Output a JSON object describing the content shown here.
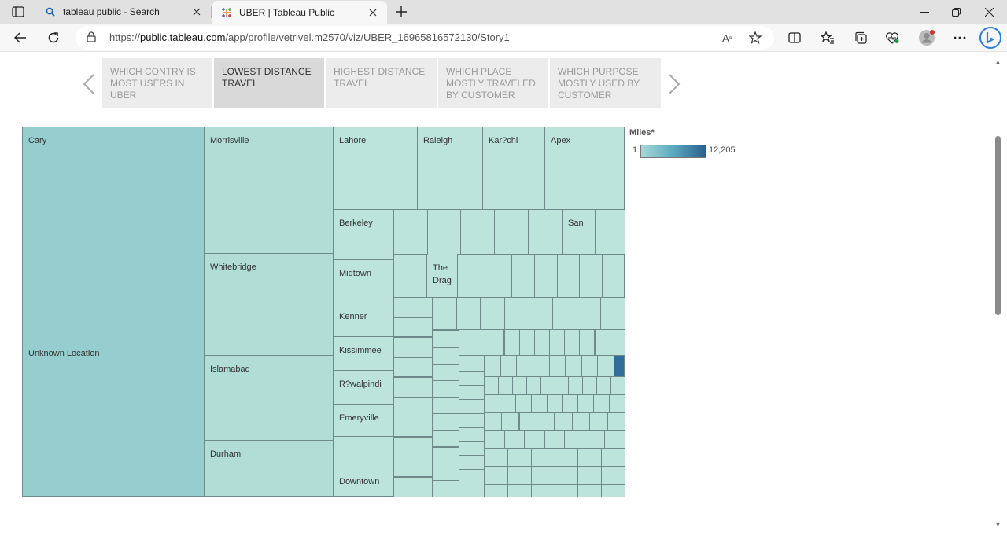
{
  "browser": {
    "tabs": [
      {
        "title": "tableau public - Search",
        "icon": "search-icon",
        "active": false
      },
      {
        "title": "UBER | Tableau Public",
        "icon": "tableau-icon",
        "active": true
      }
    ],
    "url_prefix": "https://",
    "url_host": "public.tableau.com",
    "url_path": "/app/profile/vetrivel.m2570/viz/UBER_16965816572130/Story1"
  },
  "story": {
    "points": [
      {
        "label": "WHICH CONTRY IS MOST USERS IN UBER",
        "selected": false
      },
      {
        "label": "LOWEST DISTANCE TRAVEL",
        "selected": true
      },
      {
        "label": "HIGHEST DISTANCE TRAVEL",
        "selected": false
      },
      {
        "label": "WHICH PLACE MOSTLY TRAVELED BY CUSTOMER",
        "selected": false
      },
      {
        "label": "WHICH PURPOSE MOSTLY USED BY CUSTOMER",
        "selected": false
      }
    ]
  },
  "treemap": {
    "labels": {
      "cary": "Cary",
      "unknown": "Unknown Location",
      "morrisville": "Morrisville",
      "whitebridge": "Whitebridge",
      "islamabad": "Islamabad",
      "durham": "Durham",
      "lahore": "Lahore",
      "raleigh": "Raleigh",
      "karachi": "Kar?chi",
      "apex": "Apex",
      "berkeley": "Berkeley",
      "san": "San",
      "midtown": "Midtown",
      "thedrag": "The Drag",
      "kenner": "Kenner",
      "kissimmee": "Kissimmee",
      "rawalpindi": "R?walpindi",
      "emeryville": "Emeryville",
      "downtown": "Downtown"
    }
  },
  "legend": {
    "title": "Miles*",
    "min": "1",
    "max": "12,205",
    "colors": {
      "low": "#a7d8d6",
      "high": "#2a5f8d"
    }
  }
}
